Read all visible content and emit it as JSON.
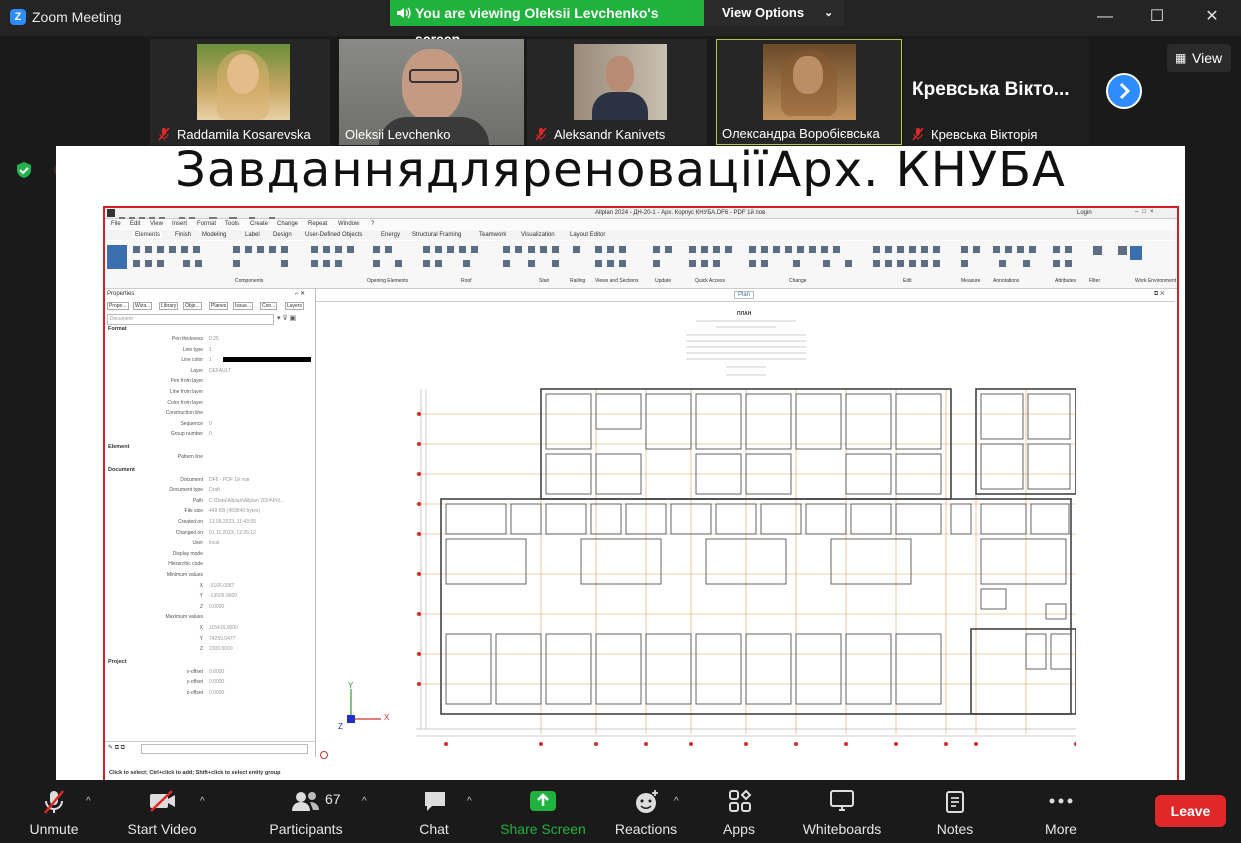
{
  "window": {
    "title": "Zoom Meeting",
    "banner": "You are viewing Oleksii Levchenko's screen",
    "view_options": "View Options",
    "controls": [
      "—",
      "☐",
      "✕"
    ]
  },
  "participants": [
    {
      "name": "Raddamila Kosarevska",
      "muted": true
    },
    {
      "name": "Oleksii Levchenko",
      "muted": false
    },
    {
      "name": "Aleksandr Kanivets",
      "muted": true
    },
    {
      "name": "Олександра Воробієвська",
      "muted": false
    },
    {
      "name": "Кревська Вікторія",
      "muted": true,
      "display": "Кревська Вікто..."
    }
  ],
  "view_button": "View",
  "share": {
    "slide_title": "ЗавданнядляреноваціїАрх. КНУБА",
    "allplan": {
      "title": "Allplan 2024 - ДН-20-1 - Арх. Корпус КНУБА.DF6 - PDF 1й пов",
      "login": "Login",
      "menu": [
        "File",
        "Edit",
        "View",
        "Insert",
        "Format",
        "Tools",
        "Create",
        "Change",
        "Repeat",
        "Window",
        "?"
      ],
      "ribbon_tabs": [
        "Elements",
        "Finish",
        "Modeling",
        "Label",
        "Design",
        "User-Defined Objects",
        "Energy",
        "Structural Framing",
        "Teamwork",
        "Visualization",
        "Layout Editor"
      ],
      "ribbon_groups": [
        "Components",
        "Opening Elements",
        "Roof",
        "Stair",
        "Railing",
        "Views and Sections",
        "Update",
        "Quick Access",
        "Change",
        "Edit",
        "Measure",
        "Annotations",
        "Attributes",
        "Filter",
        "Work Environment"
      ],
      "properties": {
        "title": "Properties",
        "tabs": [
          "Prope...",
          "Wiza...",
          "Library",
          "Obje...",
          "Planes",
          "Issue...",
          "Con...",
          "Layers"
        ],
        "selector": "Document",
        "sections": [
          {
            "title": "Format",
            "rows": [
              {
                "label": "Pen thickness",
                "value": "0.25"
              },
              {
                "label": "Line type",
                "value": "1"
              },
              {
                "label": "Line color",
                "value": "1"
              },
              {
                "label": "Layer",
                "value": "DEFAULT"
              },
              {
                "label": "Pen from layer",
                "value": ""
              },
              {
                "label": "Line from layer",
                "value": ""
              },
              {
                "label": "Color from layer",
                "value": ""
              },
              {
                "label": "Construction line",
                "value": ""
              },
              {
                "label": "Sequence",
                "value": "0"
              },
              {
                "label": "Group number",
                "value": "0"
              }
            ]
          },
          {
            "title": "Element",
            "rows": [
              {
                "label": "Pattern line",
                "value": ""
              }
            ]
          },
          {
            "title": "Document",
            "rows": [
              {
                "label": "Document",
                "value": "DF6 - PDF 1й пов"
              },
              {
                "label": "Document type",
                "value": "Draft"
              },
              {
                "label": "Path",
                "value": "C:\\Data\\Allplan\\Allplan 2024\\Prj\\..."
              },
              {
                "label": "File size",
                "value": "449 KB (459840 bytes)"
              },
              {
                "label": "Created on",
                "value": "13.09.2023, 11:43:55"
              },
              {
                "label": "Changed on",
                "value": "01.11.2023, 12:26:12"
              },
              {
                "label": "User",
                "value": "local"
              },
              {
                "label": "Display mode",
                "value": ""
              },
              {
                "label": "Hierarchic code",
                "value": ""
              },
              {
                "label": "Minimum values",
                "value": ""
              },
              {
                "label": "X",
                "value": "-3166.0087"
              },
              {
                "label": "Y",
                "value": "-13506.9600"
              },
              {
                "label": "Z",
                "value": "0.0000"
              },
              {
                "label": "Maximum values",
                "value": ""
              },
              {
                "label": "X",
                "value": "115416.0000"
              },
              {
                "label": "Y",
                "value": "74250.0477"
              },
              {
                "label": "Z",
                "value": "2300.0000"
              }
            ]
          },
          {
            "title": "Project",
            "rows": [
              {
                "label": "x-offset",
                "value": "0.0000"
              },
              {
                "label": "y-offset",
                "value": "0.0000"
              },
              {
                "label": "z-offset",
                "value": "0.0000"
              }
            ]
          }
        ]
      },
      "plan_tab": "Plan",
      "plan_heading": "ПЛАН",
      "axis_x": "X",
      "axis_y": "Y",
      "axis_z": "Z",
      "statusbar": "Click to select; Ctrl+click to add; Shift+click to select entity group"
    }
  },
  "toolbar": {
    "unmute": "Unmute",
    "start_video": "Start Video",
    "participants": "Participants",
    "participants_count": "67",
    "chat": "Chat",
    "share_screen": "Share Screen",
    "reactions": "Reactions",
    "apps": "Apps",
    "whiteboards": "Whiteboards",
    "notes": "Notes",
    "more": "More",
    "leave": "Leave"
  },
  "colors": {
    "banner": "#1fb33d",
    "share_green": "#1fb33d",
    "leave": "#e02828",
    "next_button": "#2d8cff"
  }
}
